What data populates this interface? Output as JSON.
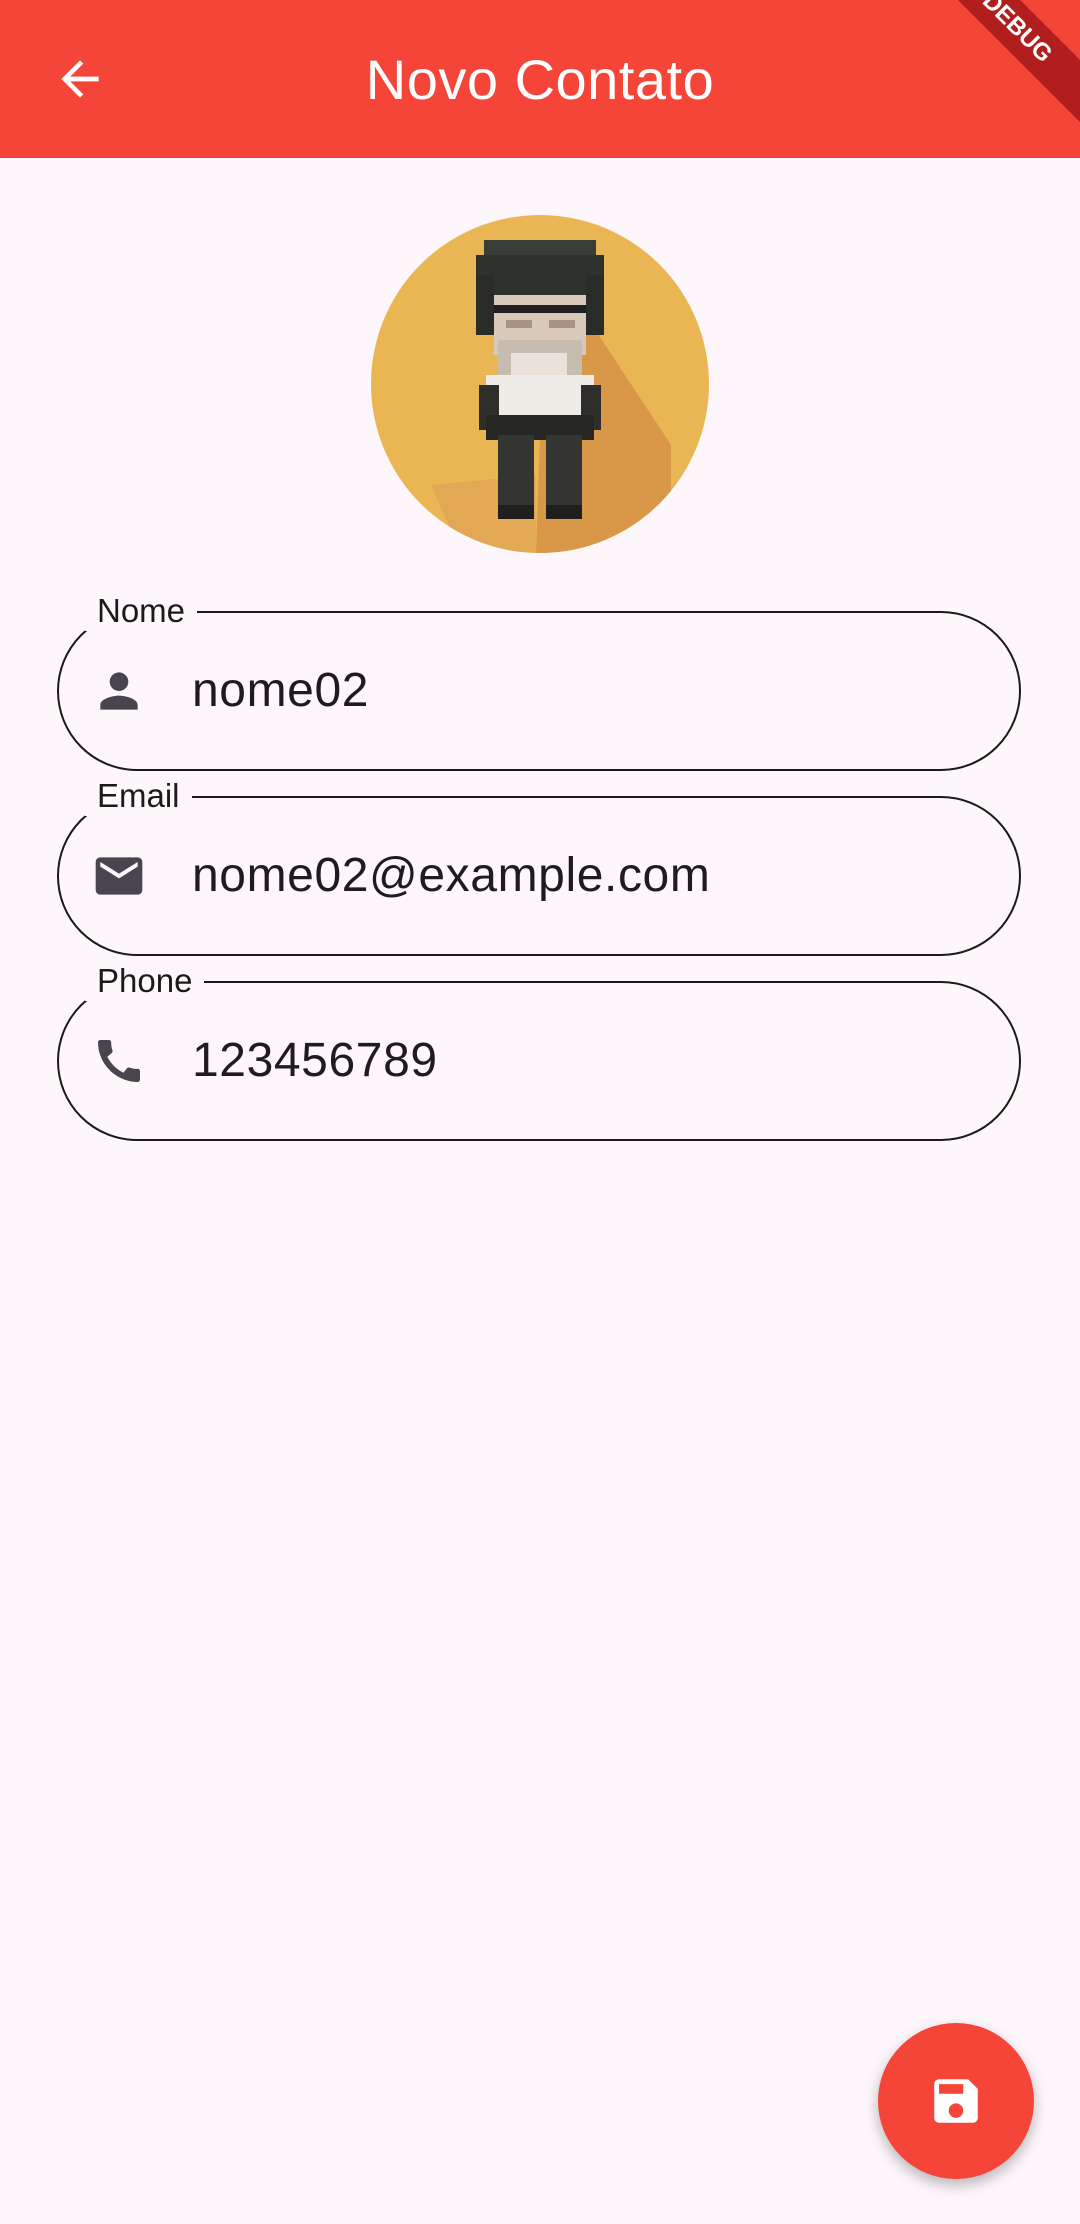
{
  "appbar": {
    "title": "Novo Contato",
    "back_icon": "arrow-back-icon",
    "color": "#f44538"
  },
  "debug_banner": "DEBUG",
  "avatar": {
    "icon": "pixel-character-avatar",
    "background": "#eab553"
  },
  "fields": [
    {
      "label": "Nome",
      "value": "nome02",
      "icon": "person-icon"
    },
    {
      "label": "Email",
      "value": "nome02@example.com",
      "icon": "email-icon"
    },
    {
      "label": "Phone",
      "value": "123456789",
      "icon": "phone-icon"
    }
  ],
  "fab": {
    "icon": "save-icon"
  }
}
